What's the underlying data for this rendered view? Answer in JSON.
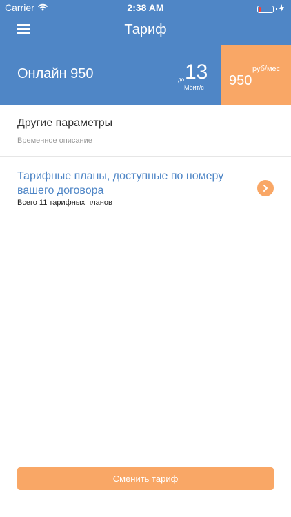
{
  "status_bar": {
    "carrier": "Carrier",
    "time": "2:38 AM",
    "battery_level": 0.15,
    "battery_color": "#ff3b30"
  },
  "nav": {
    "title": "Тариф",
    "menu_icon": "hamburger-menu-icon"
  },
  "tariff": {
    "name": "Онлайн 950",
    "speed_prefix": "до",
    "speed_value": "13",
    "speed_unit": "Мбит/с",
    "price_unit": "руб/мес",
    "price_value": "950"
  },
  "params": {
    "title": "Другие параметры",
    "description": "Временное описание"
  },
  "plans": {
    "title": "Тарифные планы, доступные по номеру вашего договора",
    "count_text": "Всего 11 тарифных планов",
    "icon": "chevron-right-icon"
  },
  "actions": {
    "change_tariff": "Сменить тариф"
  },
  "colors": {
    "primary": "#4f86c6",
    "accent": "#f9a766"
  }
}
